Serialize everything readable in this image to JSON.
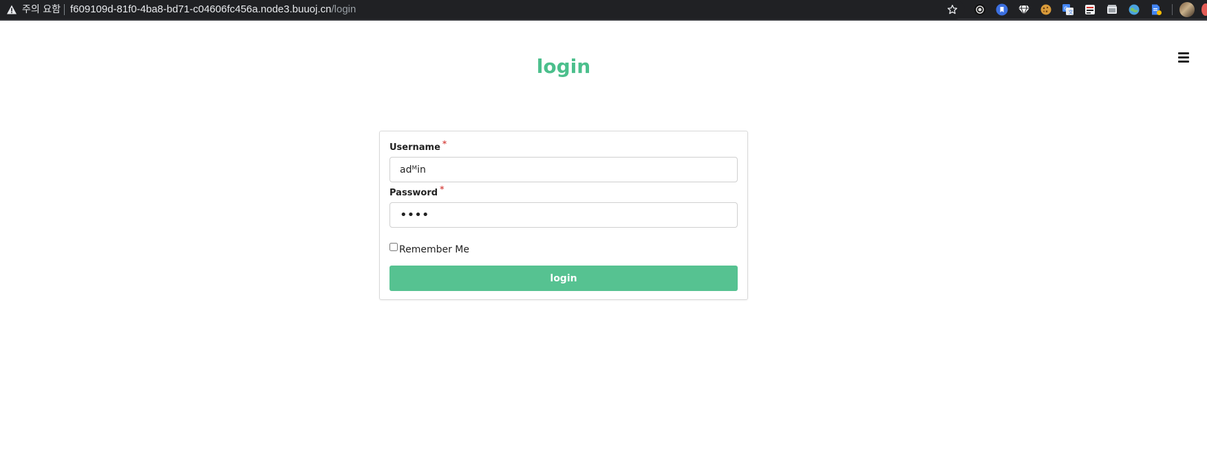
{
  "browser": {
    "security_warning": "주의 요함",
    "url_host": "f609109d-81f0-4ba8-bd71-c04606fc456a.node3.buuoj.cn",
    "url_path": "/login",
    "extensions": [
      "record-icon",
      "bookmark-extension-icon",
      "gem-icon",
      "cookie-icon",
      "translate-icon",
      "tab-manager-icon",
      "screenshot-icon",
      "globe-icon",
      "docs-extension-icon"
    ]
  },
  "page": {
    "title": "login"
  },
  "form": {
    "username_label": "Username",
    "username_required": "*",
    "username_value": "adᴹin",
    "password_label": "Password",
    "password_required": "*",
    "password_value": "••••",
    "remember_label": "Remember Me",
    "remember_checked": false,
    "submit_label": "login"
  },
  "colors": {
    "accent": "#4bbf8c",
    "button": "#56c291",
    "required": "#d9534f"
  }
}
